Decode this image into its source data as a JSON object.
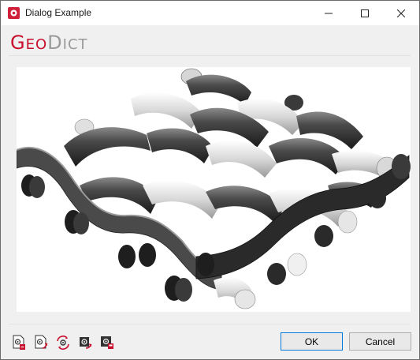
{
  "window": {
    "title": "Dialog Example",
    "controls": [
      "minimize-icon",
      "maximize-icon",
      "close-icon"
    ]
  },
  "brand": {
    "part1_initial": "G",
    "part1_rest": "EO",
    "part2_initial": "D",
    "part2_rest": "ICT",
    "colors": {
      "geo": "#c8102e",
      "dict": "#9a9a9a"
    }
  },
  "viewport": {
    "content": "3d-woven-wire-mesh-render",
    "background": "#ffffff"
  },
  "toolbar": {
    "icons": [
      "settings-export-icon",
      "settings-import-icon",
      "reset-icon",
      "load-settings-icon",
      "save-settings-icon"
    ]
  },
  "buttons": {
    "ok_label": "OK",
    "cancel_label": "Cancel"
  }
}
